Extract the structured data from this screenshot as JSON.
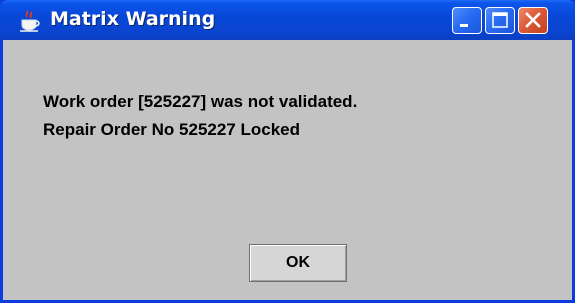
{
  "window": {
    "title": "Matrix Warning",
    "app_icon": "java-cup-icon",
    "controls": [
      "minimize-icon",
      "maximize-icon",
      "close-icon"
    ]
  },
  "message": {
    "line1": "Work order [525227] was not validated.",
    "line2": "Repair Order No 525227 Locked"
  },
  "buttons": {
    "ok_label": "OK"
  },
  "colors": {
    "titlebar": "#0a48d8",
    "content_bg": "#c3c3c3",
    "close_button": "#dc5a38"
  }
}
